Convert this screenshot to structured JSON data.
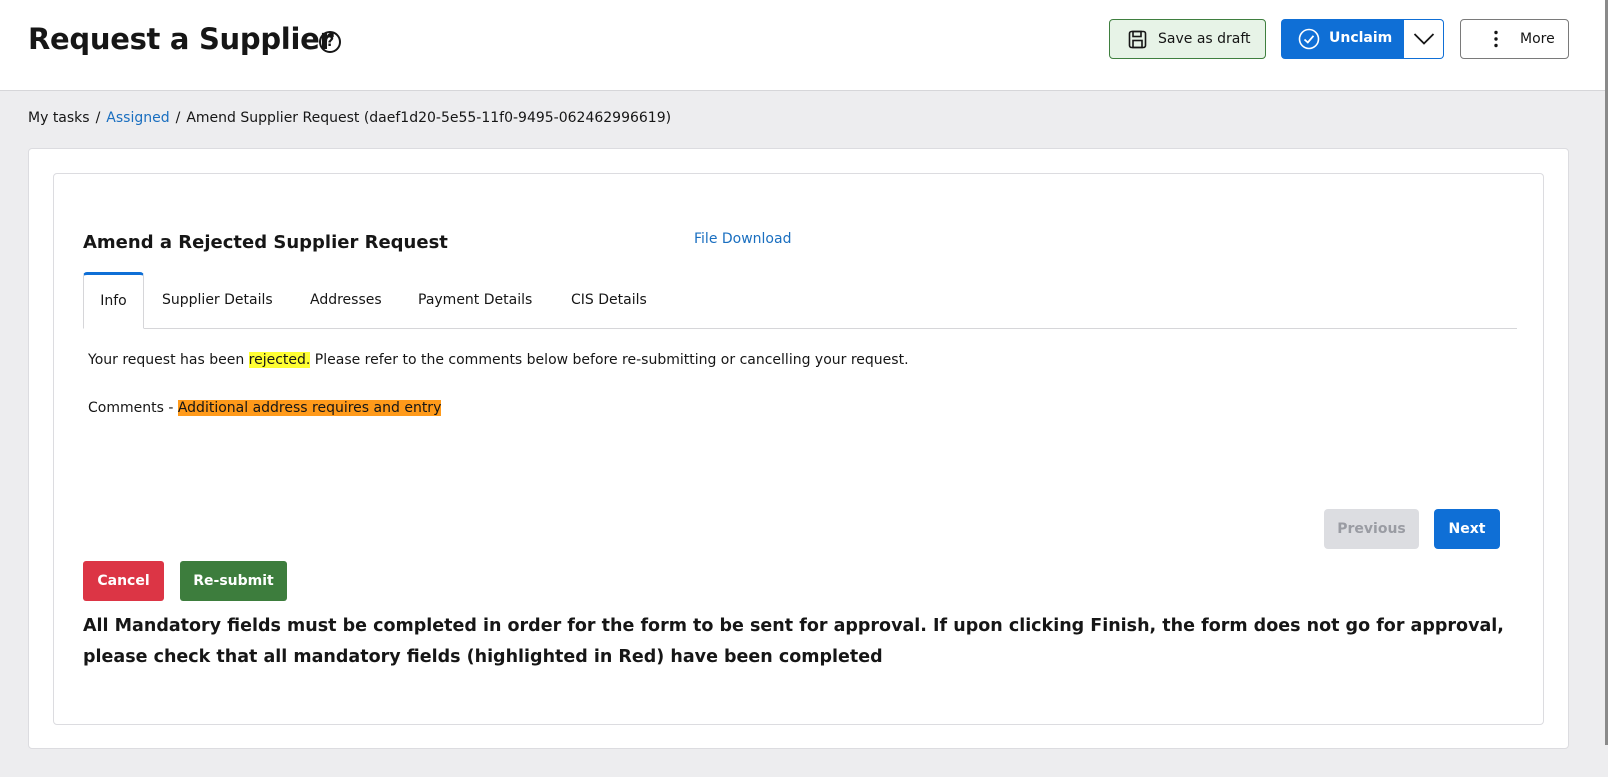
{
  "header": {
    "title": "Request a Supplier",
    "help_icon": "?",
    "save_draft_label": "Save as draft",
    "unclaim_label": "Unclaim",
    "more_label": "More"
  },
  "breadcrumb": {
    "item1": "My tasks",
    "item2": "Assigned",
    "item3": "Amend Supplier Request (daef1d20-5e55-11f0-9495-062462996619)",
    "separator": "/"
  },
  "form": {
    "title": "Amend a Rejected Supplier Request",
    "file_download": "File Download",
    "tabs": [
      "Info",
      "Supplier Details",
      "Addresses",
      "Payment Details",
      "CIS Details"
    ],
    "active_tab": "Info",
    "message_before": "Your request has been ",
    "message_highlight": "rejected.",
    "message_after": " Please refer to the comments below before re-submitting or cancelling your request.",
    "comments_label": "Comments - ",
    "comments_value": "Additional address requires and entry",
    "previous_label": "Previous",
    "next_label": "Next",
    "cancel_label": "Cancel",
    "resubmit_label": "Re-submit",
    "mandatory_note": "All Mandatory fields must be completed in order for the form to be sent for approval.  If upon clicking Finish, the form does not go for approval, please check that all mandatory fields (highlighted in Red) have been completed"
  },
  "colors": {
    "primary": "#0f6fd6",
    "danger": "#dc3545",
    "success": "#3d7d3d",
    "highlight_yellow": "#ffff33",
    "highlight_orange": "#ff9a1a"
  }
}
